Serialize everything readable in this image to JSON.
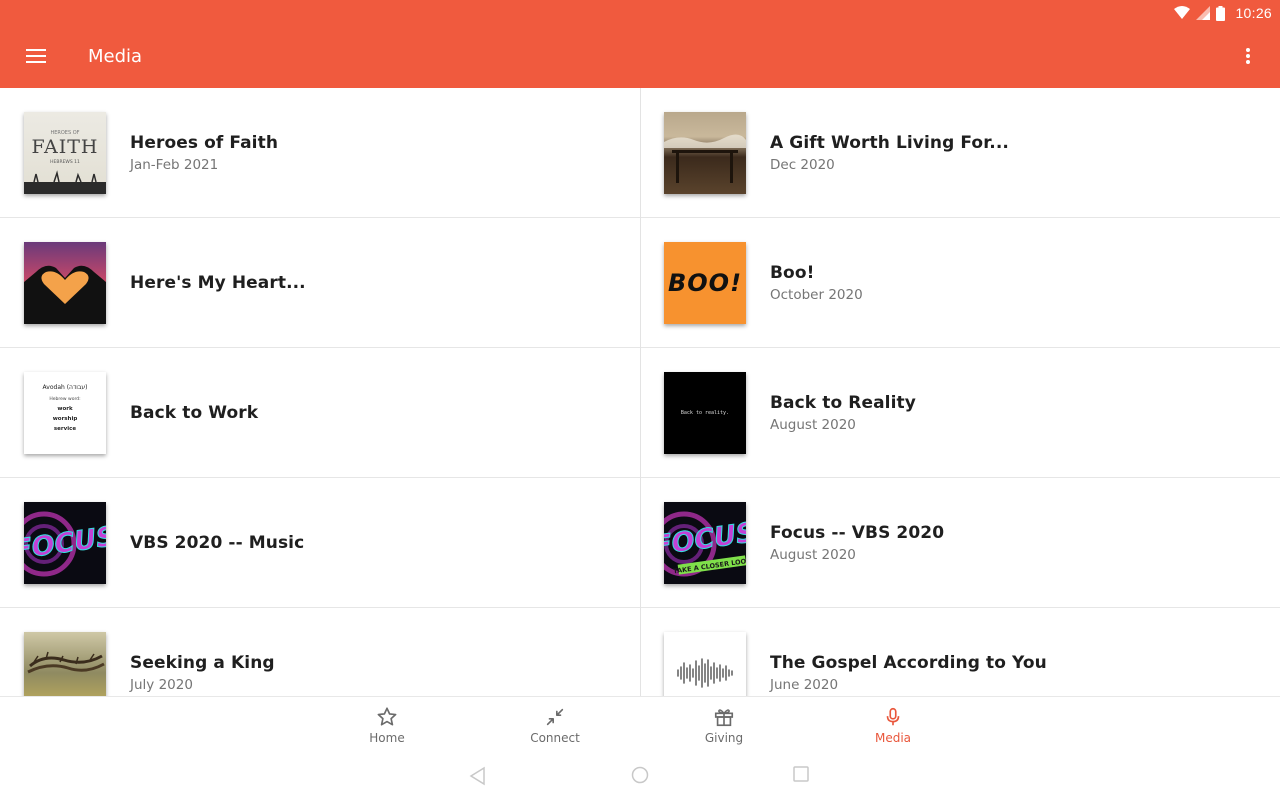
{
  "status_bar": {
    "time": "10:26"
  },
  "app_bar": {
    "title": "Media",
    "menu_icon": "hamburger-menu-icon",
    "more_icon": "more-vert-icon",
    "color": "#f05a3e"
  },
  "media": {
    "items": [
      {
        "title": "Heroes of Faith",
        "subtitle": "Jan-Feb 2021",
        "thumb": "faith"
      },
      {
        "title": "A Gift Worth Living For...",
        "subtitle": "Dec 2020",
        "thumb": "gift"
      },
      {
        "title": "Here's My Heart...",
        "subtitle": "",
        "thumb": "heart"
      },
      {
        "title": "Boo!",
        "subtitle": "October 2020",
        "thumb": "boo"
      },
      {
        "title": "Back to Work",
        "subtitle": "",
        "thumb": "work"
      },
      {
        "title": "Back to Reality",
        "subtitle": "August 2020",
        "thumb": "reality"
      },
      {
        "title": "VBS 2020 -- Music",
        "subtitle": "",
        "thumb": "focus"
      },
      {
        "title": "Focus -- VBS 2020",
        "subtitle": "August 2020",
        "thumb": "focus2"
      },
      {
        "title": "Seeking a King",
        "subtitle": "July 2020",
        "thumb": "king"
      },
      {
        "title": "The Gospel According to You",
        "subtitle": "June 2020",
        "thumb": "gospel"
      }
    ]
  },
  "thumb_text": {
    "faith_small": "HEROES OF",
    "faith_big": "FAITH",
    "faith_ref": "HEBREWS 11",
    "boo": "BOO!",
    "work_line1": "Avodah (עבודה)",
    "work_line2": "Hebrew word:",
    "work_line3": "work",
    "work_line4": "worship",
    "work_line5": "service",
    "reality": "Back to reality.",
    "focus": "FOCUS",
    "focus_sub": "TAKE A CLOSER LOOK"
  },
  "bottom_nav": {
    "items": [
      {
        "label": "Home",
        "icon": "star-icon"
      },
      {
        "label": "Connect",
        "icon": "connect-arrows-icon"
      },
      {
        "label": "Giving",
        "icon": "gift-icon"
      },
      {
        "label": "Media",
        "icon": "microphone-icon",
        "active": true
      }
    ],
    "active_color": "#e9573c"
  }
}
